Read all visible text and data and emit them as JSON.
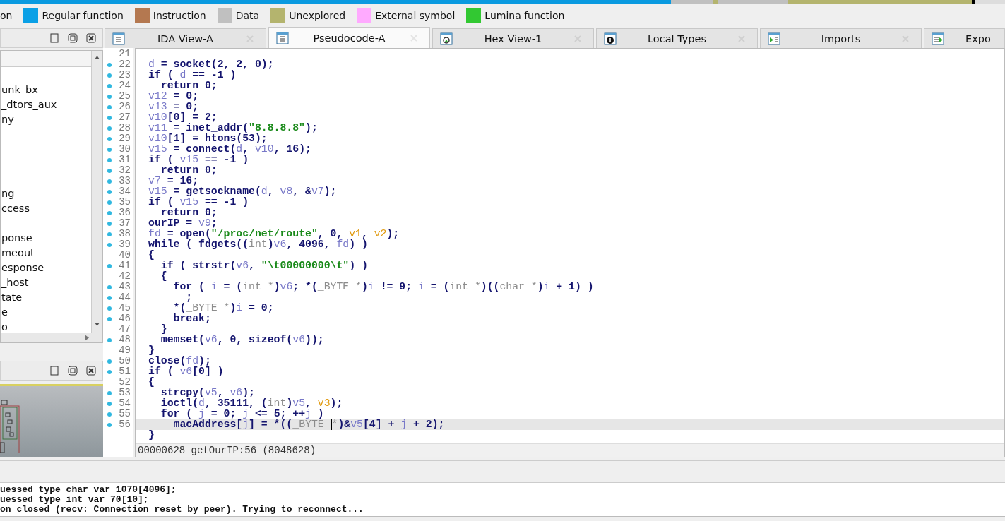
{
  "legend": [
    {
      "label": "on"
    },
    {
      "label": "Regular function",
      "color": "#0aa0e6"
    },
    {
      "label": "Instruction",
      "color": "#b47850"
    },
    {
      "label": "Data",
      "color": "#c0c0c0"
    },
    {
      "label": "Unexplored",
      "color": "#b4b46e"
    },
    {
      "label": "External symbol",
      "color": "#ffaaff"
    },
    {
      "label": "Lumina function",
      "color": "#32c832"
    }
  ],
  "functions_panel": {
    "items": [
      {
        "label": "unk_bx"
      },
      {
        "label": "_dtors_aux"
      },
      {
        "label": "ny"
      },
      {
        "label": "ng"
      },
      {
        "label": "ccess"
      },
      {
        "label": "ponse"
      },
      {
        "label": "meout"
      },
      {
        "label": "esponse"
      },
      {
        "label": "_host"
      },
      {
        "label": "tate"
      },
      {
        "label": "e"
      },
      {
        "label": "o"
      }
    ]
  },
  "tabs": [
    {
      "label": "IDA View-A",
      "kind": "listing",
      "selected": false
    },
    {
      "label": "Pseudocode-A",
      "kind": "listing",
      "selected": true
    },
    {
      "label": "Hex View-1",
      "kind": "hex",
      "selected": false
    },
    {
      "label": "Local Types",
      "kind": "types",
      "selected": false
    },
    {
      "label": "Imports",
      "kind": "imports",
      "selected": false
    },
    {
      "label": "Expo",
      "kind": "exports",
      "selected": false
    }
  ],
  "code": {
    "lines": [
      {
        "num": "21",
        "dot": false
      },
      {
        "num": "22",
        "dot": true,
        "tokens": [
          {
            "text": "d",
            "kind": "var"
          },
          {
            "text": " = socket(2, 2, 0);",
            "kind": "plain"
          }
        ]
      },
      {
        "num": "23",
        "dot": true,
        "tokens": [
          {
            "text": "if ( ",
            "kind": "plain"
          },
          {
            "text": "d",
            "kind": "var"
          },
          {
            "text": " == -1 )",
            "kind": "plain"
          }
        ]
      },
      {
        "num": "24",
        "dot": true,
        "tokens": [
          {
            "text": "  return 0;",
            "kind": "plain"
          }
        ]
      },
      {
        "num": "25",
        "dot": true,
        "tokens": [
          {
            "text": "v12",
            "kind": "var"
          },
          {
            "text": " = 0;",
            "kind": "plain"
          }
        ]
      },
      {
        "num": "26",
        "dot": true,
        "tokens": [
          {
            "text": "v13",
            "kind": "var"
          },
          {
            "text": " = 0;",
            "kind": "plain"
          }
        ]
      },
      {
        "num": "27",
        "dot": true,
        "tokens": [
          {
            "text": "v10",
            "kind": "var"
          },
          {
            "text": "[0] = 2;",
            "kind": "plain"
          }
        ]
      },
      {
        "num": "28",
        "dot": true,
        "tokens": [
          {
            "text": "v11",
            "kind": "var"
          },
          {
            "text": " = inet_addr(",
            "kind": "plain"
          },
          {
            "text": "\"8.8.8.8\"",
            "kind": "string"
          },
          {
            "text": ");",
            "kind": "plain"
          }
        ]
      },
      {
        "num": "29",
        "dot": true,
        "tokens": [
          {
            "text": "v10",
            "kind": "var"
          },
          {
            "text": "[1] = htons(53);",
            "kind": "plain"
          }
        ]
      },
      {
        "num": "30",
        "dot": true,
        "tokens": [
          {
            "text": "v15",
            "kind": "var"
          },
          {
            "text": " = connect(",
            "kind": "plain"
          },
          {
            "text": "d",
            "kind": "var"
          },
          {
            "text": ", ",
            "kind": "plain"
          },
          {
            "text": "v10",
            "kind": "var"
          },
          {
            "text": ", 16);",
            "kind": "plain"
          }
        ]
      },
      {
        "num": "31",
        "dot": true,
        "tokens": [
          {
            "text": "if ( ",
            "kind": "plain"
          },
          {
            "text": "v15",
            "kind": "var"
          },
          {
            "text": " == -1 )",
            "kind": "plain"
          }
        ]
      },
      {
        "num": "32",
        "dot": true,
        "tokens": [
          {
            "text": "  return 0;",
            "kind": "plain"
          }
        ]
      },
      {
        "num": "33",
        "dot": true,
        "tokens": [
          {
            "text": "v7",
            "kind": "var"
          },
          {
            "text": " = 16;",
            "kind": "plain"
          }
        ]
      },
      {
        "num": "34",
        "dot": true,
        "tokens": [
          {
            "text": "v15",
            "kind": "var"
          },
          {
            "text": " = getsockname(",
            "kind": "plain"
          },
          {
            "text": "d",
            "kind": "var"
          },
          {
            "text": ", ",
            "kind": "plain"
          },
          {
            "text": "v8",
            "kind": "var"
          },
          {
            "text": ", &",
            "kind": "plain"
          },
          {
            "text": "v7",
            "kind": "var"
          },
          {
            "text": ");",
            "kind": "plain"
          }
        ]
      },
      {
        "num": "35",
        "dot": true,
        "tokens": [
          {
            "text": "if ( ",
            "kind": "plain"
          },
          {
            "text": "v15",
            "kind": "var"
          },
          {
            "text": " == -1 )",
            "kind": "plain"
          }
        ]
      },
      {
        "num": "36",
        "dot": true,
        "tokens": [
          {
            "text": "  return 0;",
            "kind": "plain"
          }
        ]
      },
      {
        "num": "37",
        "dot": true,
        "tokens": [
          {
            "text": "ourIP = ",
            "kind": "plain"
          },
          {
            "text": "v9",
            "kind": "var"
          },
          {
            "text": ";",
            "kind": "plain"
          }
        ]
      },
      {
        "num": "38",
        "dot": true,
        "tokens": [
          {
            "text": "fd",
            "kind": "var"
          },
          {
            "text": " = open(",
            "kind": "plain"
          },
          {
            "text": "\"/proc/net/route\"",
            "kind": "string"
          },
          {
            "text": ", 0, ",
            "kind": "plain"
          },
          {
            "text": "v1",
            "kind": "arg"
          },
          {
            "text": ", ",
            "kind": "plain"
          },
          {
            "text": "v2",
            "kind": "arg"
          },
          {
            "text": ");",
            "kind": "plain"
          }
        ]
      },
      {
        "num": "39",
        "dot": true,
        "tokens": [
          {
            "text": "while ( fdgets((",
            "kind": "plain"
          },
          {
            "text": "int",
            "kind": "type"
          },
          {
            "text": ")",
            "kind": "plain"
          },
          {
            "text": "v6",
            "kind": "var"
          },
          {
            "text": ", 4096, ",
            "kind": "plain"
          },
          {
            "text": "fd",
            "kind": "var"
          },
          {
            "text": ") )",
            "kind": "plain"
          }
        ]
      },
      {
        "num": "40",
        "dot": false,
        "tokens": [
          {
            "text": "{",
            "kind": "plain"
          }
        ]
      },
      {
        "num": "41",
        "dot": true,
        "tokens": [
          {
            "text": "  if ( strstr(",
            "kind": "plain"
          },
          {
            "text": "v6",
            "kind": "var"
          },
          {
            "text": ", ",
            "kind": "plain"
          },
          {
            "text": "\"\\t00000000\\t\"",
            "kind": "string"
          },
          {
            "text": ") )",
            "kind": "plain"
          }
        ]
      },
      {
        "num": "42",
        "dot": false,
        "tokens": [
          {
            "text": "  {",
            "kind": "plain"
          }
        ]
      },
      {
        "num": "43",
        "dot": true,
        "tokens": [
          {
            "text": "    for ( ",
            "kind": "plain"
          },
          {
            "text": "i",
            "kind": "var"
          },
          {
            "text": " = (",
            "kind": "plain"
          },
          {
            "text": "int *",
            "kind": "type"
          },
          {
            "text": ")",
            "kind": "plain"
          },
          {
            "text": "v6",
            "kind": "var"
          },
          {
            "text": "; *(",
            "kind": "plain"
          },
          {
            "text": "_BYTE *",
            "kind": "type"
          },
          {
            "text": ")",
            "kind": "plain"
          },
          {
            "text": "i",
            "kind": "var"
          },
          {
            "text": " != 9; ",
            "kind": "plain"
          },
          {
            "text": "i",
            "kind": "var"
          },
          {
            "text": " = (",
            "kind": "plain"
          },
          {
            "text": "int *",
            "kind": "type"
          },
          {
            "text": ")((",
            "kind": "plain"
          },
          {
            "text": "char *",
            "kind": "type"
          },
          {
            "text": ")",
            "kind": "plain"
          },
          {
            "text": "i",
            "kind": "var"
          },
          {
            "text": " + 1) )",
            "kind": "plain"
          }
        ]
      },
      {
        "num": "44",
        "dot": true,
        "tokens": [
          {
            "text": "      ;",
            "kind": "plain"
          }
        ]
      },
      {
        "num": "45",
        "dot": true,
        "tokens": [
          {
            "text": "    *(",
            "kind": "plain"
          },
          {
            "text": "_BYTE *",
            "kind": "type"
          },
          {
            "text": ")",
            "kind": "plain"
          },
          {
            "text": "i",
            "kind": "var"
          },
          {
            "text": " = 0;",
            "kind": "plain"
          }
        ]
      },
      {
        "num": "46",
        "dot": true,
        "tokens": [
          {
            "text": "    break;",
            "kind": "plain"
          }
        ]
      },
      {
        "num": "47",
        "dot": false,
        "tokens": [
          {
            "text": "  }",
            "kind": "plain"
          }
        ]
      },
      {
        "num": "48",
        "dot": true,
        "tokens": [
          {
            "text": "  memset(",
            "kind": "plain"
          },
          {
            "text": "v6",
            "kind": "var"
          },
          {
            "text": ", 0, sizeof(",
            "kind": "plain"
          },
          {
            "text": "v6",
            "kind": "var"
          },
          {
            "text": "));",
            "kind": "plain"
          }
        ]
      },
      {
        "num": "49",
        "dot": false,
        "tokens": [
          {
            "text": "}",
            "kind": "plain"
          }
        ]
      },
      {
        "num": "50",
        "dot": true,
        "tokens": [
          {
            "text": "close(",
            "kind": "plain"
          },
          {
            "text": "fd",
            "kind": "var"
          },
          {
            "text": ");",
            "kind": "plain"
          }
        ]
      },
      {
        "num": "51",
        "dot": true,
        "tokens": [
          {
            "text": "if ( ",
            "kind": "plain"
          },
          {
            "text": "v6",
            "kind": "var"
          },
          {
            "text": "[0] )",
            "kind": "plain"
          }
        ]
      },
      {
        "num": "52",
        "dot": false,
        "tokens": [
          {
            "text": "{",
            "kind": "plain"
          }
        ]
      },
      {
        "num": "53",
        "dot": true,
        "tokens": [
          {
            "text": "  strcpy(",
            "kind": "plain"
          },
          {
            "text": "v5",
            "kind": "var"
          },
          {
            "text": ", ",
            "kind": "plain"
          },
          {
            "text": "v6",
            "kind": "var"
          },
          {
            "text": ");",
            "kind": "plain"
          }
        ]
      },
      {
        "num": "54",
        "dot": true,
        "tokens": [
          {
            "text": "  ioctl(",
            "kind": "plain"
          },
          {
            "text": "d",
            "kind": "var"
          },
          {
            "text": ", 35111, (",
            "kind": "plain"
          },
          {
            "text": "int",
            "kind": "type"
          },
          {
            "text": ")",
            "kind": "plain"
          },
          {
            "text": "v5",
            "kind": "var"
          },
          {
            "text": ", ",
            "kind": "plain"
          },
          {
            "text": "v3",
            "kind": "arg"
          },
          {
            "text": ");",
            "kind": "plain"
          }
        ]
      },
      {
        "num": "55",
        "dot": true,
        "tokens": [
          {
            "text": "  for ( ",
            "kind": "plain"
          },
          {
            "text": "j",
            "kind": "var"
          },
          {
            "text": " = 0; ",
            "kind": "plain"
          },
          {
            "text": "j",
            "kind": "var"
          },
          {
            "text": " <= 5; ++",
            "kind": "plain"
          },
          {
            "text": "j",
            "kind": "var"
          },
          {
            "text": " )",
            "kind": "plain"
          }
        ]
      },
      {
        "num": "56",
        "dot": true,
        "current": true,
        "tokens": [
          {
            "text": "    macAddress[",
            "kind": "plain"
          },
          {
            "text": "j",
            "kind": "var"
          },
          {
            "text": "] = *((",
            "kind": "plain"
          },
          {
            "text": "_BYTE ",
            "kind": "type"
          },
          {
            "text": "*",
            "kind": "type-caret"
          },
          {
            "text": ")&",
            "kind": "plain"
          },
          {
            "text": "v5",
            "kind": "var"
          },
          {
            "text": "[4] + ",
            "kind": "plain"
          },
          {
            "text": "j",
            "kind": "var"
          },
          {
            "text": " + 2);",
            "kind": "plain"
          }
        ]
      },
      {
        "dot": false,
        "tokens": [
          {
            "text": "}",
            "kind": "plain"
          }
        ]
      }
    ],
    "status": "00000628 getOurIP:56 (8048628)"
  },
  "output": {
    "lines": [
      "uessed type char var_1070[4096];",
      "uessed type int var_70[10];",
      "on closed (recv: Connection reset by peer). Trying to reconnect..."
    ]
  }
}
